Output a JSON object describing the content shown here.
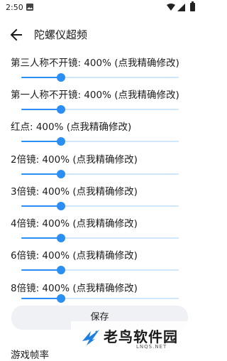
{
  "status_bar": {
    "time": "2:50"
  },
  "app_bar": {
    "title": "陀螺仪超频"
  },
  "settings": [
    {
      "label": "第三人称不开镜: 400% (点我精确修改)",
      "value_fraction": 0.25
    },
    {
      "label": "第一人称不开镜: 400% (点我精确修改)",
      "value_fraction": 0.25
    },
    {
      "label": "红点: 400% (点我精确修改)",
      "value_fraction": 0.25
    },
    {
      "label": "2倍镜: 400% (点我精确修改)",
      "value_fraction": 0.25
    },
    {
      "label": "3倍镜: 400% (点我精确修改)",
      "value_fraction": 0.25
    },
    {
      "label": "4倍镜: 400% (点我精确修改)",
      "value_fraction": 0.25
    },
    {
      "label": "6倍镜: 400% (点我精确修改)",
      "value_fraction": 0.25
    },
    {
      "label": "8倍镜: 400% (点我精确修改)",
      "value_fraction": 0.25
    }
  ],
  "save_button": {
    "label": "保存"
  },
  "next_section": {
    "label": "游戏帧率"
  },
  "watermark": {
    "text": "老鸟软件园",
    "sub": "LNQS.NET"
  },
  "colors": {
    "accent": "#2a8ef2",
    "track": "#cfe6fb",
    "button_bg": "#eff1f4"
  }
}
